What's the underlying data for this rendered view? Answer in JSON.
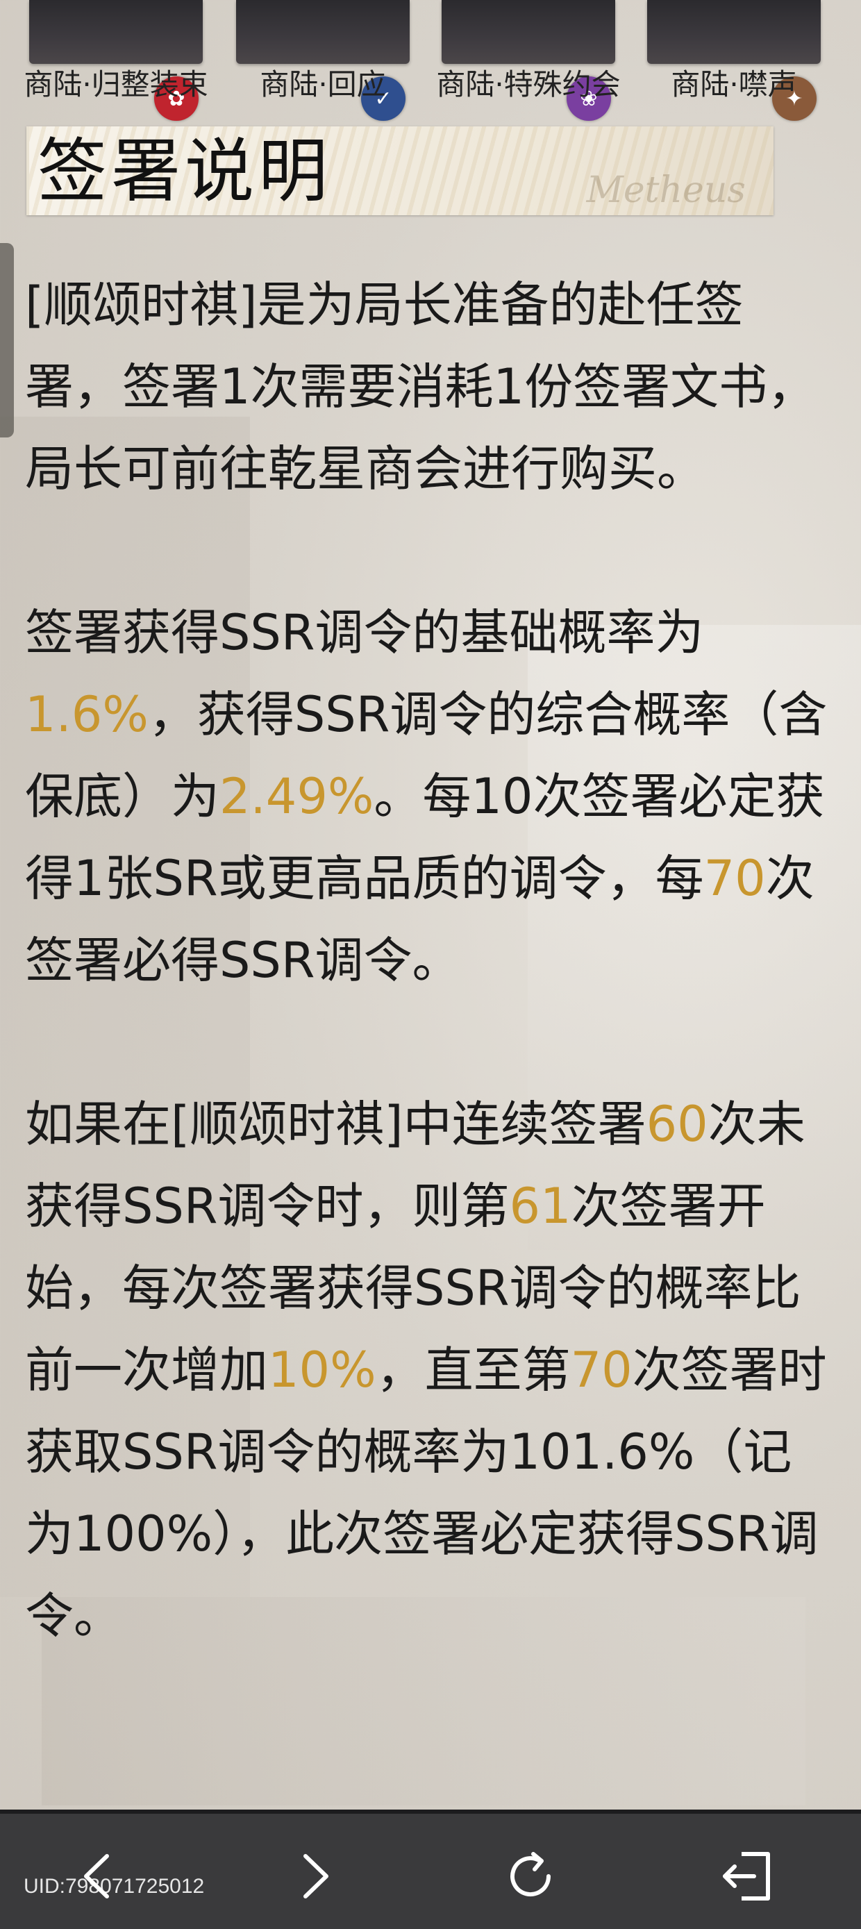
{
  "tabs": [
    {
      "label": "商陆·归整装束",
      "icon": "tag-icon",
      "badge_color": "#c0242e"
    },
    {
      "label": "商陆·回应",
      "icon": "check-icon",
      "badge_color": "#2f4f8f"
    },
    {
      "label": "商陆·特殊约会",
      "icon": "spiral-icon",
      "badge_color": "#7a3fa0"
    },
    {
      "label": "商陆·噤声",
      "icon": "seal-icon",
      "badge_color": "#8a5a3a"
    }
  ],
  "header": {
    "title": "签署说明",
    "script": "Metheus"
  },
  "paragraphs": {
    "p1": "[顺颂时祺]是为局长准备的赴任签署，签署1次需要消耗1份签署文书，局长可前往乾星商会进行购买。",
    "p2": {
      "a": "签署获得SSR调令的基础概率为",
      "base_rate": "1.6%",
      "b": "，获得SSR调令的综合概率（含保底）为",
      "total_rate": "2.49%",
      "c": "。每10次签署必定获得1张SR或更高品质的调令，每",
      "pity": "70",
      "d": "次签署必得SSR调令。"
    },
    "p3": {
      "a": "如果在[顺颂时祺]中连续签署",
      "n60": "60",
      "b": "次未获得SSR调令时，则第",
      "n61": "61",
      "c": "次签署开始，每次签署获得SSR调令的概率比前一次增加",
      "inc": "10%",
      "d": "，直至第",
      "n70": "70",
      "e": "次签署时获取SSR调令的概率为101.6%（记为100%），此次签署必定获得SSR调令。"
    }
  },
  "bottom_bar": {
    "uid": "UID:798071725012",
    "buttons": [
      "back-icon",
      "forward-icon",
      "refresh-icon",
      "exit-icon"
    ]
  },
  "colors": {
    "highlight": "#c8962e",
    "bar": "#3a3a3c"
  }
}
